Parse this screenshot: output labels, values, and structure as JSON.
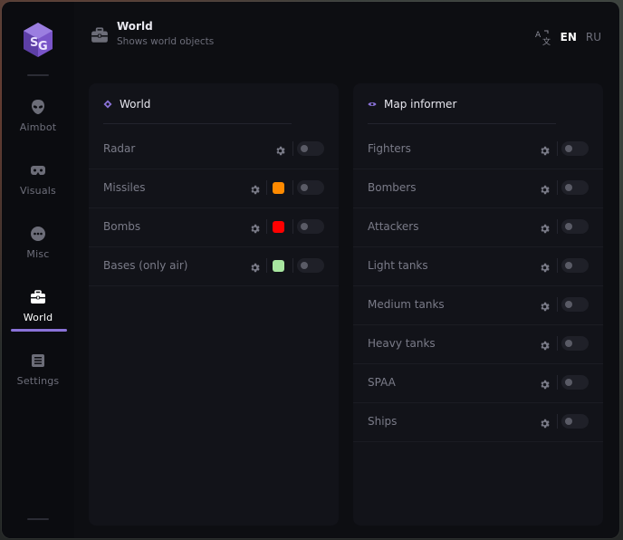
{
  "sidebar": {
    "items": [
      {
        "label": "Aimbot",
        "icon": "alien-icon"
      },
      {
        "label": "Visuals",
        "icon": "vr-goggles-icon"
      },
      {
        "label": "Misc",
        "icon": "dots-bubble-icon"
      },
      {
        "label": "World",
        "icon": "briefcase-icon",
        "active": true
      },
      {
        "label": "Settings",
        "icon": "list-settings-icon"
      }
    ]
  },
  "header": {
    "title": "World",
    "subtitle": "Shows world objects"
  },
  "language": {
    "en": "EN",
    "ru": "RU",
    "active": "EN"
  },
  "panels": {
    "world": {
      "title": "World",
      "rows": [
        {
          "label": "Radar",
          "color": null,
          "enabled": false
        },
        {
          "label": "Missiles",
          "color": "#ff8a00",
          "enabled": false
        },
        {
          "label": "Bombs",
          "color": "#ff0000",
          "enabled": false
        },
        {
          "label": "Bases (only air)",
          "color": "#a8e6a0",
          "enabled": false
        }
      ]
    },
    "map_informer": {
      "title": "Map informer",
      "rows": [
        {
          "label": "Fighters",
          "enabled": false
        },
        {
          "label": "Bombers",
          "enabled": false
        },
        {
          "label": "Attackers",
          "enabled": false
        },
        {
          "label": "Light tanks",
          "enabled": false
        },
        {
          "label": "Medium tanks",
          "enabled": false
        },
        {
          "label": "Heavy tanks",
          "enabled": false
        },
        {
          "label": "SPAA",
          "enabled": false
        },
        {
          "label": "Ships",
          "enabled": false
        }
      ]
    }
  },
  "colors": {
    "accent": "#8a72d8",
    "panel_bg": "#121319",
    "window_bg": "#0d0e12"
  }
}
